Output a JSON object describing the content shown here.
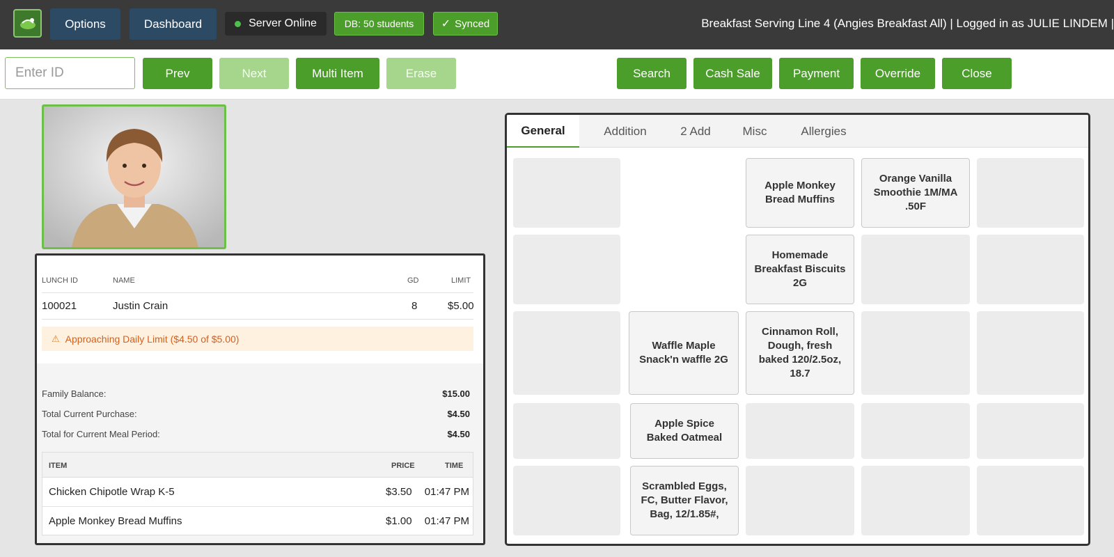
{
  "topbar": {
    "options_label": "Options",
    "dashboard_label": "Dashboard",
    "server_status": "Server Online",
    "db_status": "DB: 50 students",
    "sync_status": "Synced",
    "header_info": "Breakfast Serving Line 4 (Angies Breakfast All) | Logged in as JULIE LINDEM |"
  },
  "actions": {
    "id_placeholder": "Enter ID",
    "prev": "Prev",
    "next": "Next",
    "multi_item": "Multi Item",
    "erase": "Erase",
    "search": "Search",
    "cash_sale": "Cash Sale",
    "payment": "Payment",
    "override": "Override",
    "close": "Close"
  },
  "student": {
    "headers": {
      "lunch_id": "LUNCH ID",
      "name": "NAME",
      "gd": "GD",
      "limit": "LIMIT"
    },
    "lunch_id": "100021",
    "name": "Justin Crain",
    "gd": "8",
    "limit": "$5.00",
    "warning": "Approaching Daily Limit ($4.50 of $5.00)",
    "family_balance_label": "Family Balance:",
    "family_balance": "$15.00",
    "current_purchase_label": "Total Current Purchase:",
    "current_purchase": "$4.50",
    "meal_period_label": "Total for Current Meal Period:",
    "meal_period": "$4.50"
  },
  "purchases": {
    "headers": {
      "item": "ITEM",
      "price": "PRICE",
      "time": "TIME"
    },
    "rows": [
      {
        "item": "Chicken Chipotle Wrap K-5",
        "price": "$3.50",
        "time": "01:47 PM"
      },
      {
        "item": "Apple Monkey Bread Muffins",
        "price": "$1.00",
        "time": "01:47 PM"
      }
    ]
  },
  "menu": {
    "tabs": [
      "General",
      "Addition",
      "2 Add",
      "Misc",
      "Allergies"
    ],
    "active_tab": "General",
    "items": {
      "apple_monkey": "Apple Monkey Bread Muffins",
      "orange_vanilla": "Orange Vanilla Smoothie 1M/MA .50F",
      "biscuits": "Homemade Breakfast Biscuits 2G",
      "waffle": "Waffle Maple Snack'n waffle 2G",
      "cinnamon": "Cinnamon Roll, Dough, fresh baked 120/2.5oz, 18.7",
      "oatmeal": "Apple Spice Baked Oatmeal",
      "eggs": "Scrambled Eggs, FC, Butter Flavor, Bag, 12/1.85#,"
    }
  },
  "colors": {
    "topbar": "#3a3a3a",
    "nav_button": "#2c4a63",
    "accent_green": "#4c9e2a",
    "disabled_green": "#a6d58c",
    "warning_bg": "#fff1e0",
    "warning_text": "#d4601c"
  },
  "icons": {
    "logo": "school-lunch-logo-icon",
    "warning": "warning-triangle-icon",
    "sync": "checkmark-icon",
    "server": "status-dot-icon"
  }
}
